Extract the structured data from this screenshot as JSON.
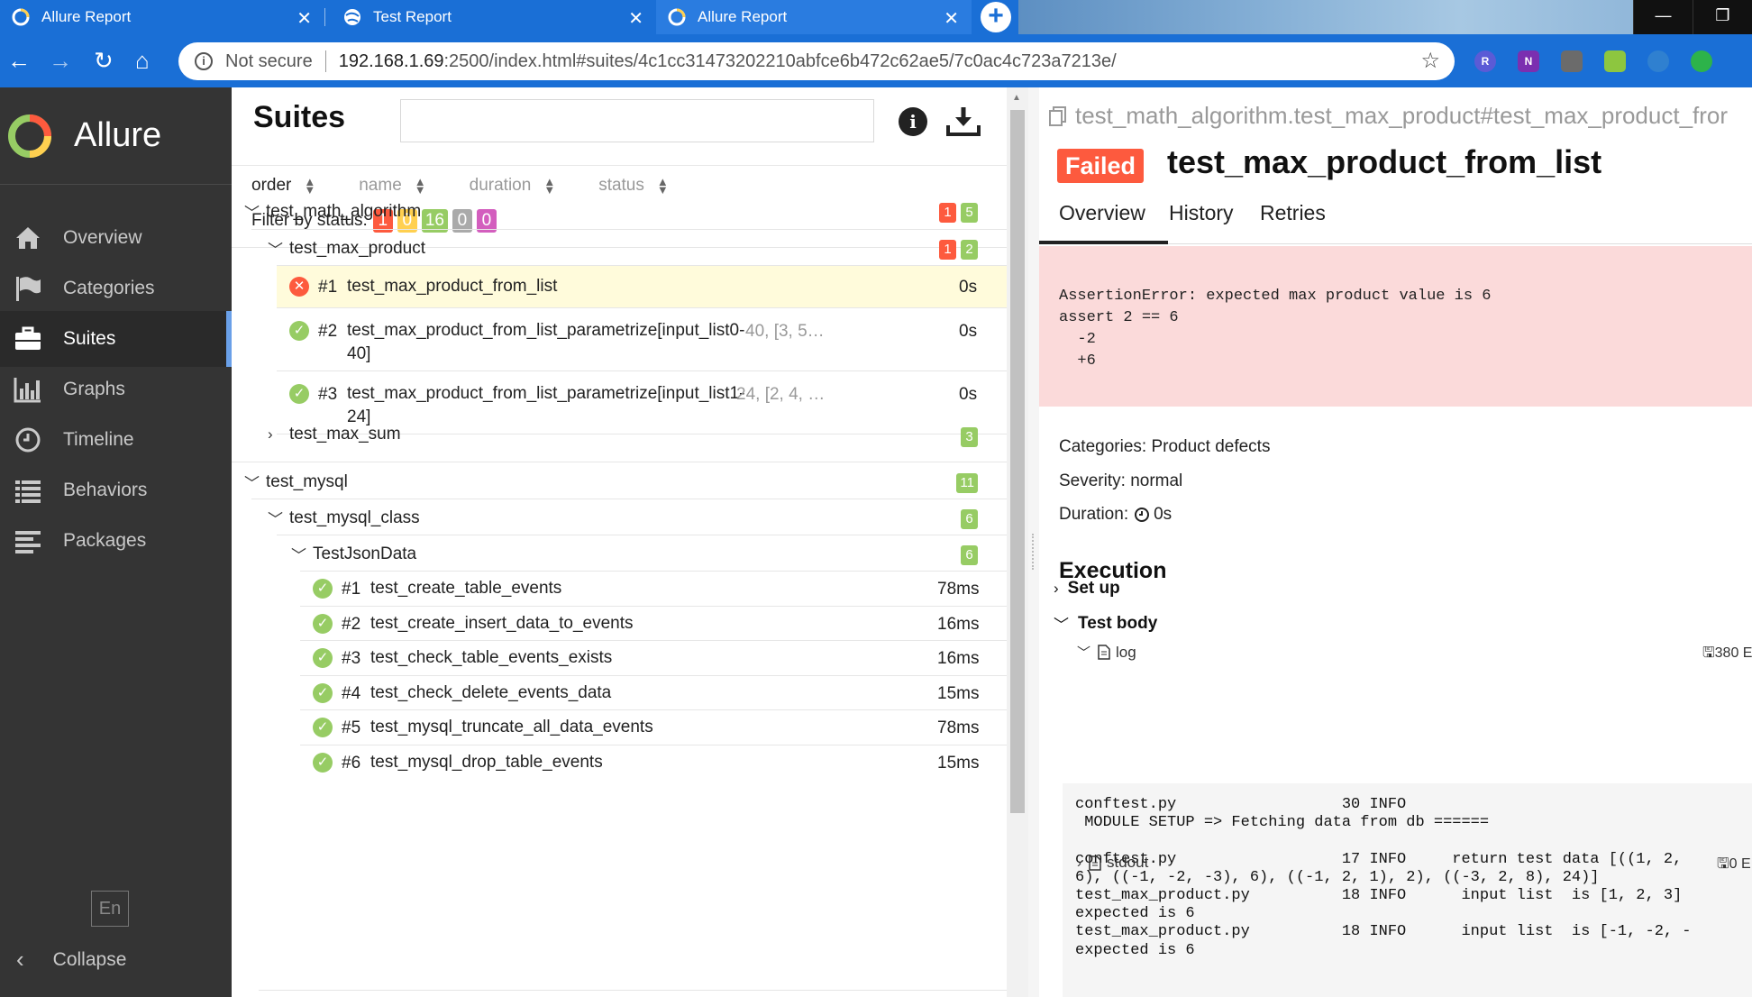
{
  "browser": {
    "tabs": [
      {
        "title": "Allure Report",
        "active": false
      },
      {
        "title": "Test Report",
        "active": false
      },
      {
        "title": "Allure Report",
        "active": true
      }
    ],
    "address": {
      "security_label": "Not secure",
      "host": "192.168.1.69",
      "rest": ":2500/index.html#suites/4c1cc31473202210abfce6b472c62ae5/7c0ac4c723a7213e/"
    },
    "extensions": [
      "R",
      "N",
      "",
      "",
      "",
      ""
    ]
  },
  "sidebar": {
    "brand": "Allure",
    "items": [
      {
        "label": "Overview",
        "icon": "home-icon",
        "active": false
      },
      {
        "label": "Categories",
        "icon": "flag-icon",
        "active": false
      },
      {
        "label": "Suites",
        "icon": "briefcase-icon",
        "active": true
      },
      {
        "label": "Graphs",
        "icon": "bar-chart-icon",
        "active": false
      },
      {
        "label": "Timeline",
        "icon": "clock-icon",
        "active": false
      },
      {
        "label": "Behaviors",
        "icon": "list-icon",
        "active": false
      },
      {
        "label": "Packages",
        "icon": "align-left-icon",
        "active": false
      }
    ],
    "language": "En",
    "collapse_label": "Collapse"
  },
  "suites": {
    "title": "Suites",
    "search_value": "",
    "sort_columns": [
      "order",
      "name",
      "duration",
      "status"
    ],
    "filter_label": "Filter by status:",
    "status_counts": {
      "failed": "1",
      "broken": "0",
      "passed": "16",
      "skipped": "0",
      "unknown": "0"
    },
    "tree": {
      "g1": {
        "name": "test_math_algorithm",
        "failed": "1",
        "passed": "5"
      },
      "g1a": {
        "name": "test_max_product",
        "failed": "1",
        "passed": "2"
      },
      "g1a_cases": [
        {
          "num": "#1",
          "name": "test_max_product_from_list",
          "params": "",
          "duration": "0s",
          "status": "failed"
        },
        {
          "num": "#2",
          "name": "test_max_product_from_list_parametrize[input_list0-",
          "name2": "40]",
          "params": "40, [3, 5…",
          "duration": "0s",
          "status": "passed"
        },
        {
          "num": "#3",
          "name": "test_max_product_from_list_parametrize[input_list1-",
          "name2": "24]",
          "params": "24, [2, 4, …",
          "duration": "0s",
          "status": "passed"
        }
      ],
      "g1b": {
        "name": "test_max_sum",
        "passed": "3"
      },
      "g2": {
        "name": "test_mysql",
        "passed": "11"
      },
      "g2a": {
        "name": "test_mysql_class",
        "passed": "6"
      },
      "g2a1": {
        "name": "TestJsonData",
        "passed": "6"
      },
      "g2_cases": [
        {
          "num": "#1",
          "name": "test_create_table_events",
          "duration": "78ms"
        },
        {
          "num": "#2",
          "name": "test_create_insert_data_to_events",
          "duration": "16ms"
        },
        {
          "num": "#3",
          "name": "test_check_table_events_exists",
          "duration": "16ms"
        },
        {
          "num": "#4",
          "name": "test_check_delete_events_data",
          "duration": "15ms"
        },
        {
          "num": "#5",
          "name": "test_mysql_truncate_all_data_events",
          "duration": "78ms"
        },
        {
          "num": "#6",
          "name": "test_mysql_drop_table_events",
          "duration": "15ms"
        }
      ]
    }
  },
  "detail": {
    "path": "test_math_algorithm.test_max_product#test_max_product_fror",
    "status_badge": "Failed",
    "title": "test_max_product_from_list",
    "tabs": [
      "Overview",
      "History",
      "Retries"
    ],
    "error": "AssertionError: expected max product value is 6\nassert 2 == 6\n  -2\n  +6",
    "categories": "Categories: Product defects",
    "severity": "Severity: normal",
    "duration_label": "Duration:",
    "duration_value": "0s",
    "execution_title": "Execution",
    "setup_label": "Set up",
    "body_label": "Test body",
    "log_label": "log",
    "log_size": "380 E",
    "log_text": "conftest.py                  30 INFO\n MODULE SETUP => Fetching data from db ======\n\nconftest.py                  17 INFO     return test data [((1, 2,\n6), ((-1, -2, -3), 6), ((-1, 2, 1), 2), ((-3, 2, 8), 24)]\ntest_max_product.py          18 INFO      input list  is [1, 2, 3]\nexpected is 6\ntest_max_product.py          18 INFO      input list  is [-1, -2, -\nexpected is 6",
    "stdout_label": "stdout",
    "stdout_size": "0 E"
  },
  "colors": {
    "failed": "#fd5a3e",
    "broken": "#ffd050",
    "passed": "#97cc64",
    "skipped": "#aaaaaa",
    "unknown": "#d35ebe",
    "sidebar": "#343434",
    "browser_blue": "#1a6fd6"
  }
}
